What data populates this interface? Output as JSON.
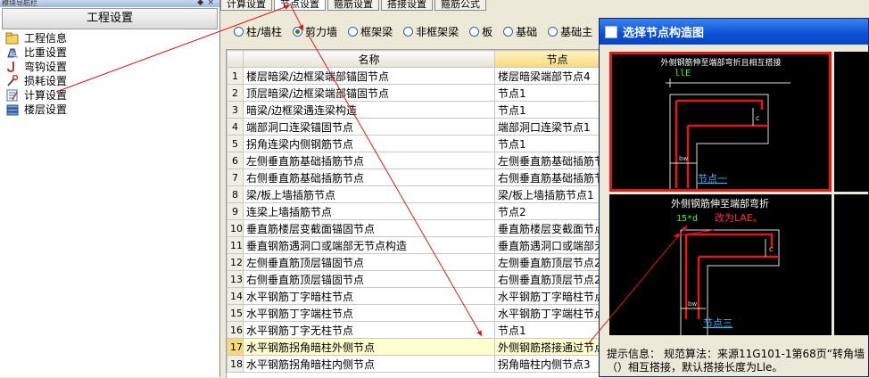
{
  "nav": {
    "top_label": "模块导航栏",
    "header": "工程设置",
    "items": [
      {
        "label": "工程信息",
        "icon": "folder-icon"
      },
      {
        "label": "比重设置",
        "icon": "weight-icon"
      },
      {
        "label": "弯钩设置",
        "icon": "hook-icon"
      },
      {
        "label": "损耗设置",
        "icon": "wrench-icon"
      },
      {
        "label": "计算设置",
        "icon": "calculator-icon"
      },
      {
        "label": "楼层设置",
        "icon": "layers-icon"
      }
    ]
  },
  "tabs": [
    "计算设置",
    "节点设置",
    "箍筋设置",
    "搭接设置",
    "箍筋公式"
  ],
  "radios": {
    "options": [
      "柱/墙柱",
      "剪力墙",
      "框架梁",
      "非框架梁",
      "板",
      "基础",
      "基础主"
    ],
    "selected": 1
  },
  "table": {
    "headers": [
      "名称",
      "节点"
    ],
    "selected_row": 17,
    "rows": [
      {
        "num": "1",
        "name": "楼层暗梁/边框梁端部锚固节点",
        "node": "楼层暗梁端部节点4"
      },
      {
        "num": "2",
        "name": "顶层暗梁/边框梁端部锚固节点",
        "node": "节点1"
      },
      {
        "num": "3",
        "name": "暗梁/边框梁遇连梁构造",
        "node": "节点1"
      },
      {
        "num": "4",
        "name": "端部洞口连梁锚固节点",
        "node": "端部洞口连梁节点1"
      },
      {
        "num": "5",
        "name": "拐角连梁内侧钢筋节点",
        "node": "节点1"
      },
      {
        "num": "6",
        "name": "左侧垂直筋基础插筋节点",
        "node": "左侧垂直筋基础插筋节点1"
      },
      {
        "num": "7",
        "name": "右侧垂直筋基础插筋节点",
        "node": "右侧垂直筋基础插筋节点1"
      },
      {
        "num": "8",
        "name": "梁/板上墙插筋节点",
        "node": "梁/板上墙插筋节点1"
      },
      {
        "num": "9",
        "name": "连梁上墙插筋节点",
        "node": "节点2"
      },
      {
        "num": "10",
        "name": "垂直筋楼层变截面锚固节点",
        "node": "垂直筋楼层变截面节点3"
      },
      {
        "num": "11",
        "name": "垂直钢筋遇洞口或端部无节点构造",
        "node": "垂直筋遇洞口或端部无节"
      },
      {
        "num": "12",
        "name": "左侧垂直筋顶层锚固节点",
        "node": "左侧垂直筋顶层节点2"
      },
      {
        "num": "13",
        "name": "右侧垂直筋顶层锚固节点",
        "node": "右侧垂直筋顶层节点2"
      },
      {
        "num": "14",
        "name": "水平钢筋丁字暗柱节点",
        "node": "水平钢筋丁字暗柱节点1"
      },
      {
        "num": "15",
        "name": "水平钢筋丁字端柱节点",
        "node": "水平钢筋丁字端柱节点1"
      },
      {
        "num": "16",
        "name": "水平钢筋丁字无柱节点",
        "node": "节点1"
      },
      {
        "num": "17",
        "name": "水平钢筋拐角暗柱外侧节点",
        "node": "外侧钢筋搭接通过节点1"
      },
      {
        "num": "18",
        "name": "水平钢筋拐角暗柱内侧节点",
        "node": "拐角暗柱内侧节点3"
      }
    ]
  },
  "dialog": {
    "title": "选择节点构造图",
    "panel1": {
      "caption": "外侧钢筋伸至端部弯折且相互搭接",
      "tag": "llE",
      "dim1": "c",
      "dim2": "bw",
      "label": "节点一"
    },
    "panel2": {
      "caption": "外侧钢筋伸至端部弯折",
      "tag": "15*d",
      "note": "改为LAE。",
      "dim1": "c",
      "dim2": "bw",
      "label": "节点三"
    },
    "hint_label": "提示信息：",
    "hint_text": "规范算法：来源11G101-1第68页“转角墙（）相互搭接，默认搭接长度为Lle。"
  },
  "colors": {
    "title_bar": "#0b4fd4",
    "selection_border": "#e01818",
    "annotation_arrow": "#e01818",
    "selected_row": "#ffffd0",
    "header_highlight": "#f8d97a"
  }
}
